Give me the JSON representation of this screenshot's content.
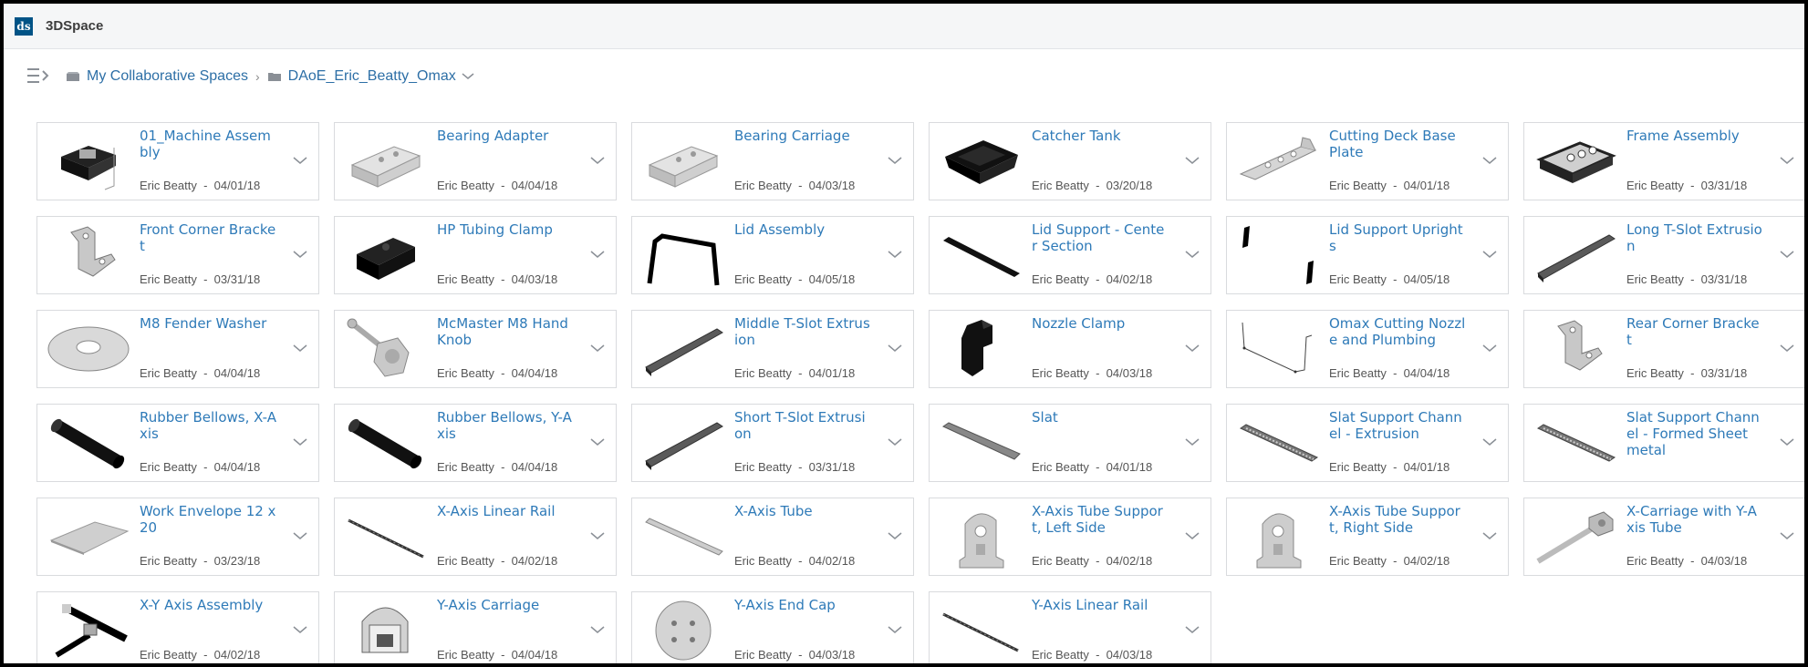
{
  "app": {
    "title": "3DSpace",
    "logo_text": "ds"
  },
  "breadcrumb": {
    "items": [
      {
        "label": "My Collaborative Spaces",
        "icon": "collab-space-icon"
      },
      {
        "label": "DAoE_Eric_Beatty_Omax",
        "icon": "folder-icon"
      }
    ],
    "separator": "›"
  },
  "cards": [
    {
      "name": "01_Machine Assembly",
      "author": "Eric Beatty",
      "date": "04/01/18",
      "thumb": "assembly"
    },
    {
      "name": "Bearing Adapter",
      "author": "Eric Beatty",
      "date": "04/04/18",
      "thumb": "block"
    },
    {
      "name": "Bearing Carriage",
      "author": "Eric Beatty",
      "date": "04/03/18",
      "thumb": "block"
    },
    {
      "name": "Catcher Tank",
      "author": "Eric Beatty",
      "date": "03/20/18",
      "thumb": "tank"
    },
    {
      "name": "Cutting Deck Base Plate",
      "author": "Eric Beatty",
      "date": "04/01/18",
      "thumb": "plate"
    },
    {
      "name": "Frame Assembly",
      "author": "Eric Beatty",
      "date": "03/31/18",
      "thumb": "frame"
    },
    {
      "name": "Front Corner Bracket",
      "author": "Eric Beatty",
      "date": "03/31/18",
      "thumb": "bracket"
    },
    {
      "name": "HP Tubing Clamp",
      "author": "Eric Beatty",
      "date": "04/03/18",
      "thumb": "clamp"
    },
    {
      "name": "Lid Assembly",
      "author": "Eric Beatty",
      "date": "04/05/18",
      "thumb": "lid"
    },
    {
      "name": "Lid Support - Center Section",
      "author": "Eric Beatty",
      "date": "04/02/18",
      "thumb": "bar"
    },
    {
      "name": "Lid Support Uprights",
      "author": "Eric Beatty",
      "date": "04/05/18",
      "thumb": "uprights"
    },
    {
      "name": "Long T-Slot Extrusion",
      "author": "Eric Beatty",
      "date": "03/31/18",
      "thumb": "rail"
    },
    {
      "name": "M8 Fender Washer",
      "author": "Eric Beatty",
      "date": "04/04/18",
      "thumb": "washer"
    },
    {
      "name": "McMaster M8 Hand Knob",
      "author": "Eric Beatty",
      "date": "04/04/18",
      "thumb": "knob"
    },
    {
      "name": "Middle T-Slot Extrusion",
      "author": "Eric Beatty",
      "date": "04/01/18",
      "thumb": "rail"
    },
    {
      "name": "Nozzle Clamp",
      "author": "Eric Beatty",
      "date": "04/03/18",
      "thumb": "nozzleclamp"
    },
    {
      "name": "Omax Cutting Nozzle and Plumbing",
      "author": "Eric Beatty",
      "date": "04/04/18",
      "thumb": "wire"
    },
    {
      "name": "Rear Corner Bracket",
      "author": "Eric Beatty",
      "date": "03/31/18",
      "thumb": "bracket"
    },
    {
      "name": "Rubber Bellows, X-Axis",
      "author": "Eric Beatty",
      "date": "04/04/18",
      "thumb": "bellows"
    },
    {
      "name": "Rubber Bellows, Y-Axis",
      "author": "Eric Beatty",
      "date": "04/04/18",
      "thumb": "bellows"
    },
    {
      "name": "Short T-Slot Extrusion",
      "author": "Eric Beatty",
      "date": "03/31/18",
      "thumb": "rail"
    },
    {
      "name": "Slat",
      "author": "Eric Beatty",
      "date": "04/01/18",
      "thumb": "slat"
    },
    {
      "name": "Slat Support Channel - Extrusion",
      "author": "Eric Beatty",
      "date": "04/01/18",
      "thumb": "slotted"
    },
    {
      "name": "Slat Support Channel - Formed Sheet metal",
      "author": "",
      "date": "",
      "thumb": "slotted"
    },
    {
      "name": "Work Envelope 12 x 20",
      "author": "Eric Beatty",
      "date": "03/23/18",
      "thumb": "sheet"
    },
    {
      "name": "X-Axis Linear Rail",
      "author": "Eric Beatty",
      "date": "04/02/18",
      "thumb": "thinrail"
    },
    {
      "name": "X-Axis Tube",
      "author": "Eric Beatty",
      "date": "04/02/18",
      "thumb": "tube"
    },
    {
      "name": "X-Axis Tube Support, Left Side",
      "author": "Eric Beatty",
      "date": "04/02/18",
      "thumb": "support"
    },
    {
      "name": "X-Axis Tube Support, Right Side",
      "author": "Eric Beatty",
      "date": "04/02/18",
      "thumb": "support"
    },
    {
      "name": "X-Carriage with Y-Axis Tube",
      "author": "Eric Beatty",
      "date": "04/03/18",
      "thumb": "carriage"
    },
    {
      "name": "X-Y Axis Assembly",
      "author": "Eric Beatty",
      "date": "04/02/18",
      "thumb": "xy"
    },
    {
      "name": "Y-Axis Carriage",
      "author": "Eric Beatty",
      "date": "04/04/18",
      "thumb": "ycarriage"
    },
    {
      "name": "Y-Axis End Cap",
      "author": "Eric Beatty",
      "date": "04/03/18",
      "thumb": "endcap"
    },
    {
      "name": "Y-Axis Linear Rail",
      "author": "Eric Beatty",
      "date": "04/03/18",
      "thumb": "thinrail"
    }
  ]
}
